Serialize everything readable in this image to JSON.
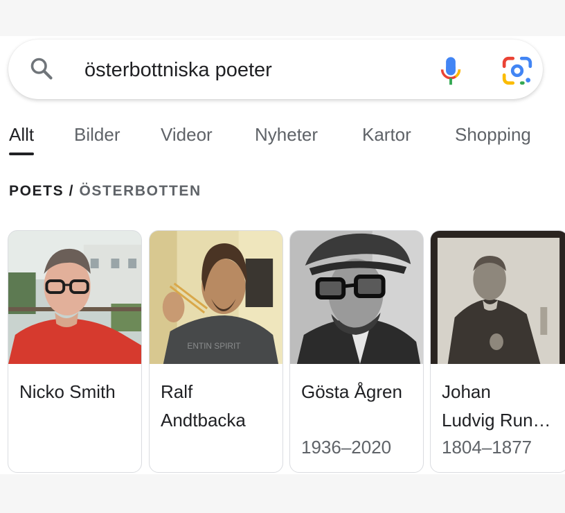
{
  "search": {
    "query": "österbottniska poeter",
    "search_icon": "search-icon",
    "mic_icon": "mic-icon",
    "lens_icon": "lens-icon"
  },
  "tabs": [
    {
      "label": "Allt",
      "active": true
    },
    {
      "label": "Bilder"
    },
    {
      "label": "Videor"
    },
    {
      "label": "Nyheter"
    },
    {
      "label": "Kartor"
    },
    {
      "label": "Shopping"
    }
  ],
  "section": {
    "title": "POETS",
    "separator": "/",
    "subtitle": "ÖSTERBOTTEN"
  },
  "cards": [
    {
      "name_line1": "Nicko Smith",
      "name_line2": "",
      "years": ""
    },
    {
      "name_line1": "Ralf",
      "name_line2": "Andtbacka",
      "years": ""
    },
    {
      "name_line1": "Gösta Ågren",
      "name_line2": "",
      "years": "1936–2020"
    },
    {
      "name_line1": "Johan",
      "name_line2": "Ludvig Runeberg",
      "years": "1804–1877"
    }
  ],
  "colors": {
    "accent_blue": "#4285f4",
    "accent_red": "#ea4335",
    "accent_yellow": "#fbbc04",
    "accent_green": "#34a853"
  }
}
